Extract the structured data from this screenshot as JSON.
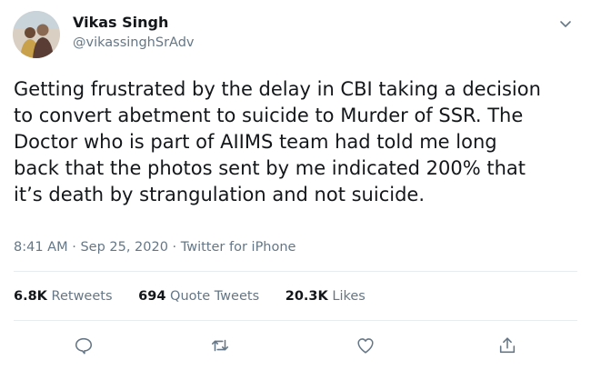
{
  "author": {
    "name": "Vikas Singh",
    "handle": "@vikassinghSrAdv"
  },
  "tweet": {
    "text": "Getting frustrated by the delay in CBI taking a decision\nto convert abetment to suicide to Murder of SSR. The\nDoctor who is part of AIIMS team had told me long\nback that the photos sent by me indicated 200% that\nit’s death by strangulation and not suicide."
  },
  "meta": {
    "time": "8:41 AM",
    "separator1": " · ",
    "date": "Sep 25, 2020",
    "separator2": " · ",
    "source": "Twitter for iPhone"
  },
  "stats": {
    "retweets_count": "6.8K",
    "retweets_label": "Retweets",
    "quotes_count": "694",
    "quotes_label": "Quote Tweets",
    "likes_count": "20.3K",
    "likes_label": "Likes"
  },
  "icons": {
    "reply": "reply-icon",
    "retweet": "retweet-icon",
    "like": "like-icon",
    "share": "share-icon",
    "more": "chevron-down-icon"
  },
  "colors": {
    "text": "#14171a",
    "secondary": "#657786",
    "divider": "#e6ecf0"
  }
}
